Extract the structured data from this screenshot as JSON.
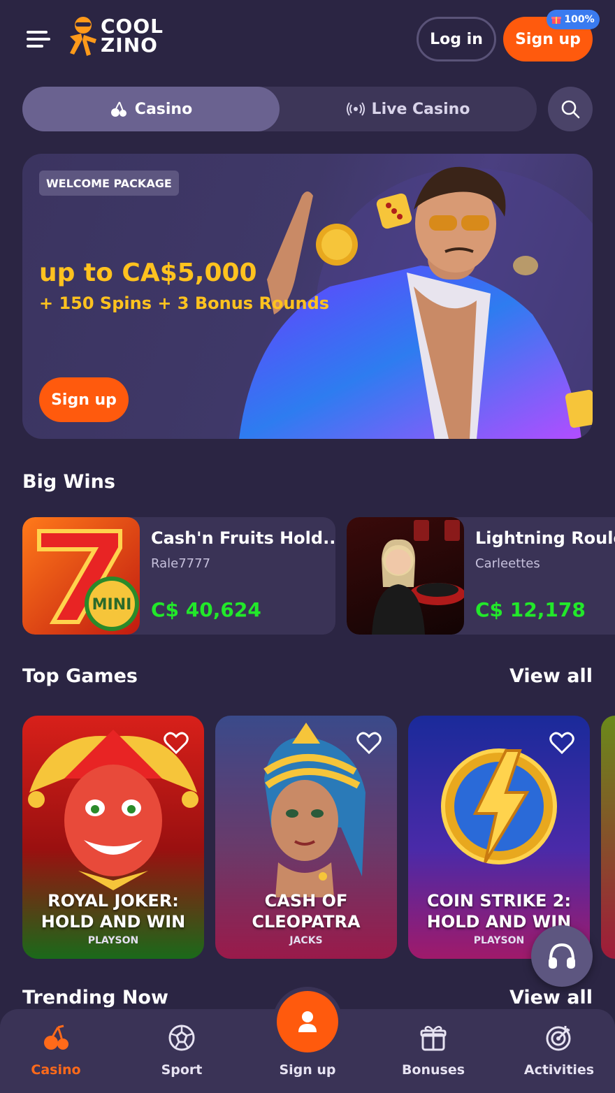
{
  "header": {
    "logo_text_line1": "COOL",
    "logo_text_line2": "ZINO",
    "login_label": "Log in",
    "signup_label": "Sign up",
    "badge_text": "100%"
  },
  "tabs": [
    {
      "label": "Casino",
      "active": true,
      "icon": "cherries-icon"
    },
    {
      "label": "Live Casino",
      "active": false,
      "icon": "broadcast-icon"
    }
  ],
  "promo": {
    "tag": "WELCOME PACKAGE",
    "amount": "up to CA$5,000",
    "subtitle": "+ 150 Spins + 3 Bonus Rounds",
    "cta": "Sign up"
  },
  "big_wins": {
    "title": "Big Wins",
    "items": [
      {
        "game": "Cash'n Fruits Hold...",
        "user": "Rale7777",
        "amount": "C$ 40,624"
      },
      {
        "game": "Lightning Roule",
        "user": "Carleettes",
        "amount": "C$ 12,178"
      }
    ]
  },
  "top_games": {
    "title": "Top Games",
    "view_all": "View all",
    "items": [
      {
        "name": "ROYAL JOKER: HOLD AND WIN",
        "provider": "PLAYSON"
      },
      {
        "name": "CASH OF CLEOPATRA",
        "provider": "JACKS"
      },
      {
        "name": "COIN STRIKE 2: HOLD AND WIN",
        "provider": "PLAYSON"
      }
    ]
  },
  "trending": {
    "title": "Trending Now",
    "view_all": "View all"
  },
  "bottom_nav": [
    {
      "label": "Casino",
      "icon": "cherries-icon",
      "active": true
    },
    {
      "label": "Sport",
      "icon": "soccer-ball-icon",
      "active": false
    },
    {
      "label": "Sign up",
      "icon": "user-icon",
      "active": false
    },
    {
      "label": "Bonuses",
      "icon": "gift-icon",
      "active": false
    },
    {
      "label": "Activities",
      "icon": "target-icon",
      "active": false
    }
  ],
  "colors": {
    "background": "#2b2543",
    "accent": "#ff5a0d",
    "gold": "#ffc21f",
    "win_green": "#22e82a"
  }
}
